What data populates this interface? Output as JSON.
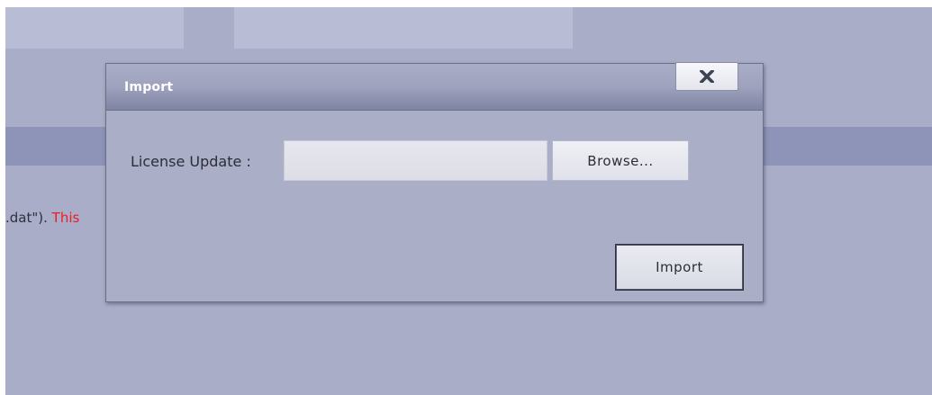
{
  "background": {
    "status_text_prefix": ".dat\"). ",
    "status_text_warning": "This",
    "warning_color": "#ee1c24"
  },
  "dialog": {
    "title": "Import",
    "close_icon": "close-x-icon",
    "license_label": "License Update :",
    "file_input_value": "",
    "browse_label": "Browse...",
    "import_label": "Import"
  }
}
